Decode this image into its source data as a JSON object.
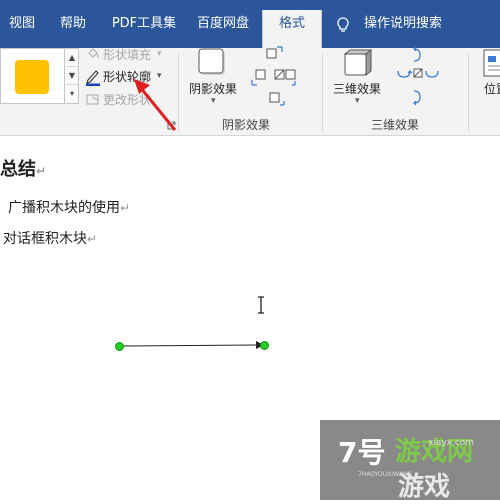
{
  "tabs": [
    {
      "label": "视图"
    },
    {
      "label": "帮助"
    },
    {
      "label": "PDF工具集"
    },
    {
      "label": "百度网盘"
    },
    {
      "label": "格式"
    }
  ],
  "tell_me": "操作说明搜索",
  "ribbon": {
    "shape_styles": {
      "fill_label": "形状填充",
      "outline_label": "形状轮廓",
      "change_shape_label": "更改形状",
      "fill_color": "#ffc000",
      "outline_color": "#1f3fbf"
    },
    "shadow_effects": {
      "button_label": "阴影效果",
      "group_label": "阴影效果"
    },
    "three_d_effects": {
      "button_label": "三维效果",
      "group_label": "三维效果"
    },
    "position": {
      "button_label": "位置"
    }
  },
  "document": {
    "heading": "总结",
    "lines": [
      "广播积木块的使用",
      "对话框积木块"
    ],
    "paragraph_mark": "↵"
  },
  "colors": {
    "tab_bar": "#2b579a",
    "ribbon_bg": "#f3f3f3",
    "annotation_arrow": "#e02020",
    "handle": "#22cc22"
  }
}
